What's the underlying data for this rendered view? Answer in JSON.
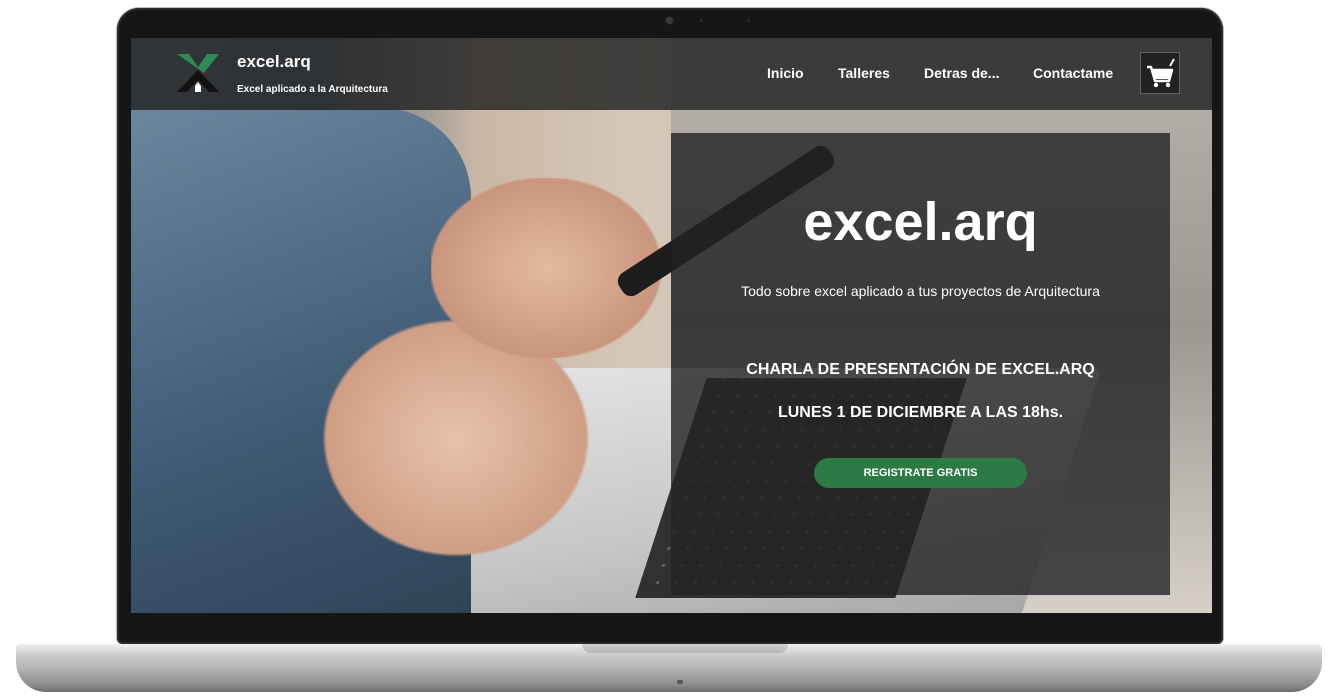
{
  "brand": {
    "name": "excel.arq",
    "tagline": "Excel aplicado a la Arquitectura"
  },
  "nav": {
    "links": [
      "Inicio",
      "Talleres",
      "Detras de...",
      "Contactame"
    ],
    "cart_icon": "shopping-cart-icon"
  },
  "hero": {
    "title": "excel.arq",
    "subtitle": "Todo sobre excel aplicado a tus proyectos de Arquitectura",
    "event": "CHARLA DE PRESENTACIÓN DE EXCEL.ARQ",
    "date": "LUNES 1 DE DICIEMBRE A LAS 18hs.",
    "cta": "REGISTRATE GRATIS"
  },
  "colors": {
    "accent": "#2c7a45",
    "nav_bg": "#282828",
    "logo_green": "#2e8b57"
  }
}
